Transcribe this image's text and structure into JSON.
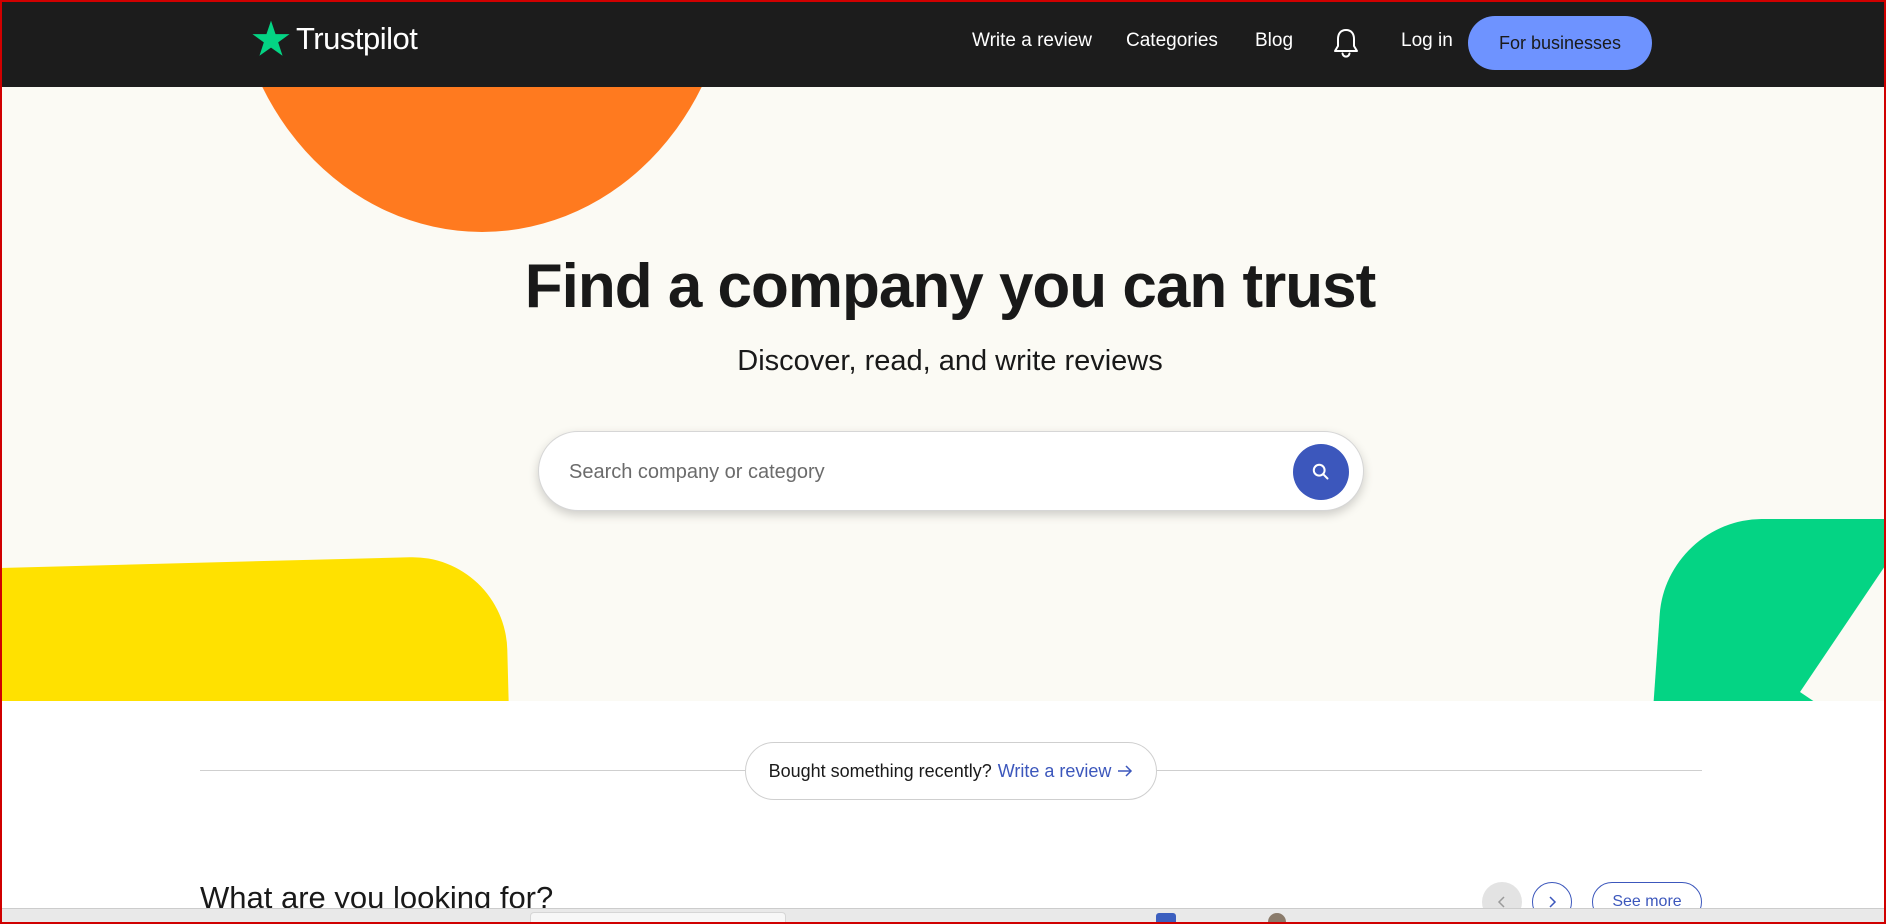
{
  "nav": {
    "logo_text": "Trustpilot",
    "links": {
      "write_review": "Write a review",
      "categories": "Categories",
      "blog": "Blog",
      "login": "Log in"
    },
    "business_button": "For businesses"
  },
  "hero": {
    "title": "Find a company you can trust",
    "subtitle": "Discover, read, and write reviews",
    "search_placeholder": "Search company or category"
  },
  "bought_banner": {
    "text": "Bought something recently?",
    "link": "Write a review"
  },
  "section": {
    "title": "What are you looking for?",
    "see_more": "See more"
  },
  "colors": {
    "nav_bg": "#1c1c1c",
    "brand_green": "#04d484",
    "accent_blue": "#3c57bc",
    "business_button": "#6e93ff",
    "orange": "#ff7a1f",
    "yellow": "#ffe100",
    "hero_bg": "#fbfaf4"
  },
  "icons": [
    "star-logo-icon",
    "bell-icon",
    "search-icon",
    "arrow-right-icon",
    "chevron-left-icon",
    "chevron-right-icon"
  ]
}
